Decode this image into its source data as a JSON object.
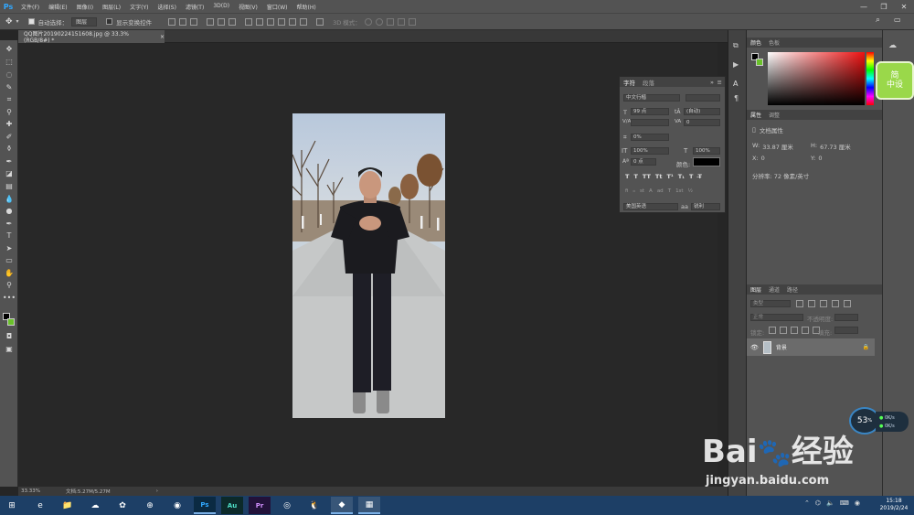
{
  "app": {
    "logo": "Ps",
    "menu": [
      "文件(F)",
      "编辑(E)",
      "图像(I)",
      "图层(L)",
      "文字(Y)",
      "选择(S)",
      "滤镜(T)",
      "3D(D)",
      "视图(V)",
      "窗口(W)",
      "帮助(H)"
    ]
  },
  "options": {
    "auto_select_label": "自动选择：",
    "auto_select_value": "图层",
    "show_transform_label": "显示变换控件",
    "mode_3d_label": "3D 模式："
  },
  "document": {
    "tab_title": "QQ图片20190224151608.jpg @ 33.3%(RGB/8#) *",
    "tab_close": "×"
  },
  "status": {
    "zoom": "33.33%",
    "doc_info": "文档:5.27M/5.27M",
    "arrow": "›"
  },
  "character_panel": {
    "tabs": [
      "字符",
      "段落"
    ],
    "font_family": "中文行楷",
    "font_size": "99 点",
    "leading": "(自动)",
    "tracking": "0",
    "scale_pct": "0%",
    "vscale": "100%",
    "hscale": "100%",
    "baseline": "0 点",
    "color_label": "颜色:",
    "language": "美国英语",
    "aa_label": "aa",
    "aa_value": "锐利",
    "style_buttons": [
      "T",
      "T",
      "TT",
      "Tt",
      "T¹",
      "T₁",
      "T",
      "T̶"
    ],
    "ot_buttons": [
      "fi",
      "ℴ",
      "st",
      "A",
      "ad",
      "T",
      "1st",
      "½"
    ]
  },
  "color_panel": {
    "tabs": [
      "颜色",
      "色板"
    ]
  },
  "properties_panel": {
    "tabs": [
      "属性",
      "调整"
    ],
    "doc_props": "文档属性",
    "w_label": "W:",
    "w_value": "33.87 厘米",
    "h_label": "H:",
    "h_value": "67.73 厘米",
    "x_label": "X:",
    "x_value": "0",
    "y_label": "Y:",
    "y_value": "0",
    "resolution": "分辨率: 72 像素/英寸"
  },
  "layers_panel": {
    "tabs": [
      "图层",
      "通道",
      "路径"
    ],
    "filter_kind": "类型",
    "blend_mode": "正常",
    "opacity_label": "不透明度:",
    "lock_label": "锁定:",
    "fill_label": "填充:",
    "layer_name": "背景"
  },
  "sidebar_badge": {
    "line1": "简",
    "line2": "中设"
  },
  "network_widget": {
    "percent": "53",
    "unit": "%",
    "up": "0K/s",
    "down": "0K/s"
  },
  "watermark": {
    "brand": "Bai",
    "brand2": "经验",
    "url": "jingyan.baidu.com"
  },
  "taskbar": {
    "time": "15:18",
    "date": "2019/2/24",
    "apps": [
      "e",
      "📁",
      "☁",
      "✿",
      "⊕",
      "◉",
      "Ps",
      "Au",
      "Pr",
      "◎",
      "🐧",
      "◆",
      "▦"
    ]
  },
  "colors": {
    "ps_blue": "#31a8ff",
    "fg_swatch": "#000000",
    "bg_swatch": "#6ac12a"
  }
}
